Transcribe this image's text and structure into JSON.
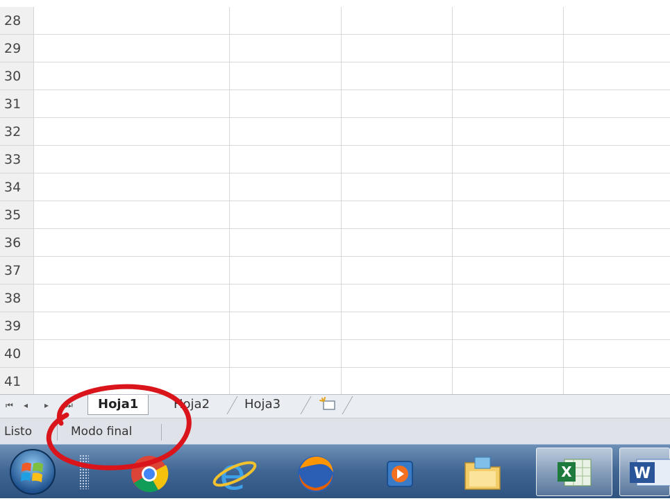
{
  "rows": [
    "28",
    "29",
    "30",
    "31",
    "32",
    "33",
    "34",
    "35",
    "36",
    "37",
    "38",
    "39",
    "40",
    "41"
  ],
  "sheet_nav": {
    "first": "⏮",
    "prev": "◂",
    "next": "▸",
    "last": "⏭"
  },
  "sheet_tabs": [
    {
      "label": "Hoja1",
      "active": true
    },
    {
      "label": "Hoja2",
      "active": false
    },
    {
      "label": "Hoja3",
      "active": false
    }
  ],
  "status_bar": {
    "ready": "Listo",
    "mode": "Modo final"
  },
  "taskbar": {
    "items": [
      "start-orb-icon",
      "chrome-icon",
      "internet-explorer-icon",
      "firefox-icon",
      "media-player-icon",
      "file-explorer-icon",
      "excel-icon",
      "word-icon"
    ]
  },
  "colors": {
    "annotation": "#d9151b",
    "excel_green": "#1f7a3e",
    "word_blue": "#2a5699"
  }
}
